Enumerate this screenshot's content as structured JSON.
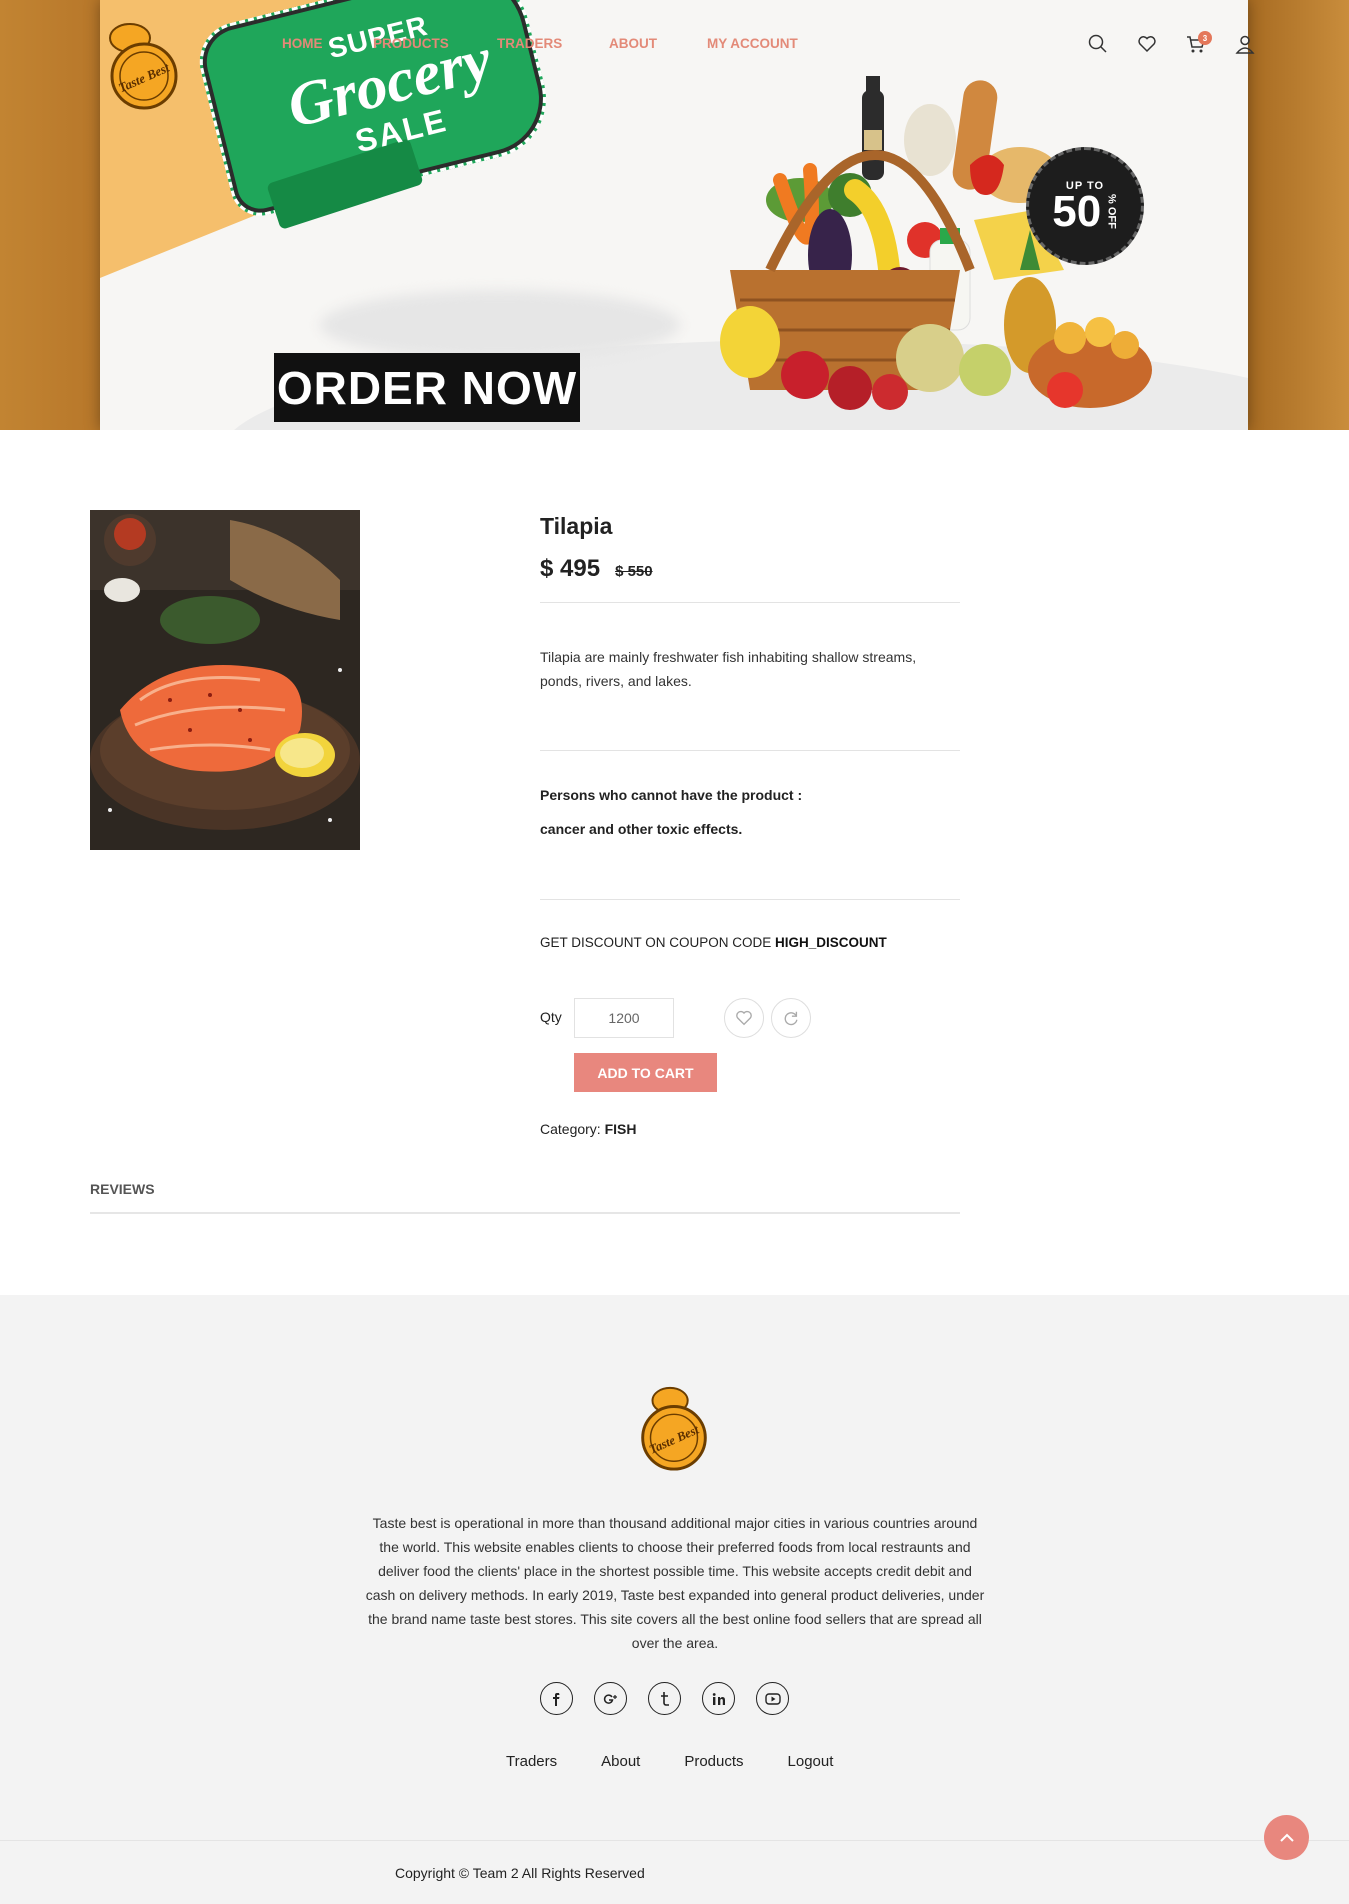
{
  "brand": {
    "logo_text": "Taste Best"
  },
  "nav": {
    "items": [
      "HOME",
      "PRODUCTS",
      "TRADERS",
      "ABOUT",
      "MY ACCOUNT"
    ],
    "cart_count": "3",
    "link_color": "#e38a78"
  },
  "banner": {
    "super": "SUPER",
    "grocery": "Grocery",
    "sale": "SALE",
    "order_now": "ORDER NOW",
    "badge_upto": "UP TO",
    "badge_value": "50",
    "badge_off": "% OFF",
    "ribbon_color": "#1fa65a"
  },
  "product": {
    "title": "Tilapia",
    "price": "$ 495",
    "old_price": "$ 550",
    "description": "Tilapia are mainly freshwater fish inhabiting shallow streams, ponds, rivers, and lakes.",
    "restriction_title": "Persons who cannot have the product :",
    "restriction_text": "cancer and other toxic effects.",
    "coupon_prefix": "GET DISCOUNT ON COUPON CODE",
    "coupon_code": "HIGH_DISCOUNT",
    "qty_label": "Qty",
    "qty_value": "1200",
    "add_to_cart": "ADD TO CART",
    "category_label": "Category:",
    "category_value": "FISH",
    "accent_color": "#e8877e"
  },
  "tabs": {
    "reviews": "REVIEWS"
  },
  "footer": {
    "about": "Taste best is operational in more than thousand additional major cities in various countries around the world. This website enables clients to choose their preferred foods from local restraunts and deliver food the clients' place in the shortest possible time. This website accepts credit debit and cash on delivery methods. In early 2019, Taste best expanded into general product deliveries, under the brand name taste best stores. This site covers all the best online food sellers that are spread all over the area.",
    "socials": [
      "facebook",
      "google-plus",
      "tumblr",
      "linkedin",
      "youtube"
    ],
    "links": [
      "Traders",
      "About",
      "Products",
      "Logout"
    ],
    "copyright": "Copyright © Team 2 All Rights Reserved"
  }
}
